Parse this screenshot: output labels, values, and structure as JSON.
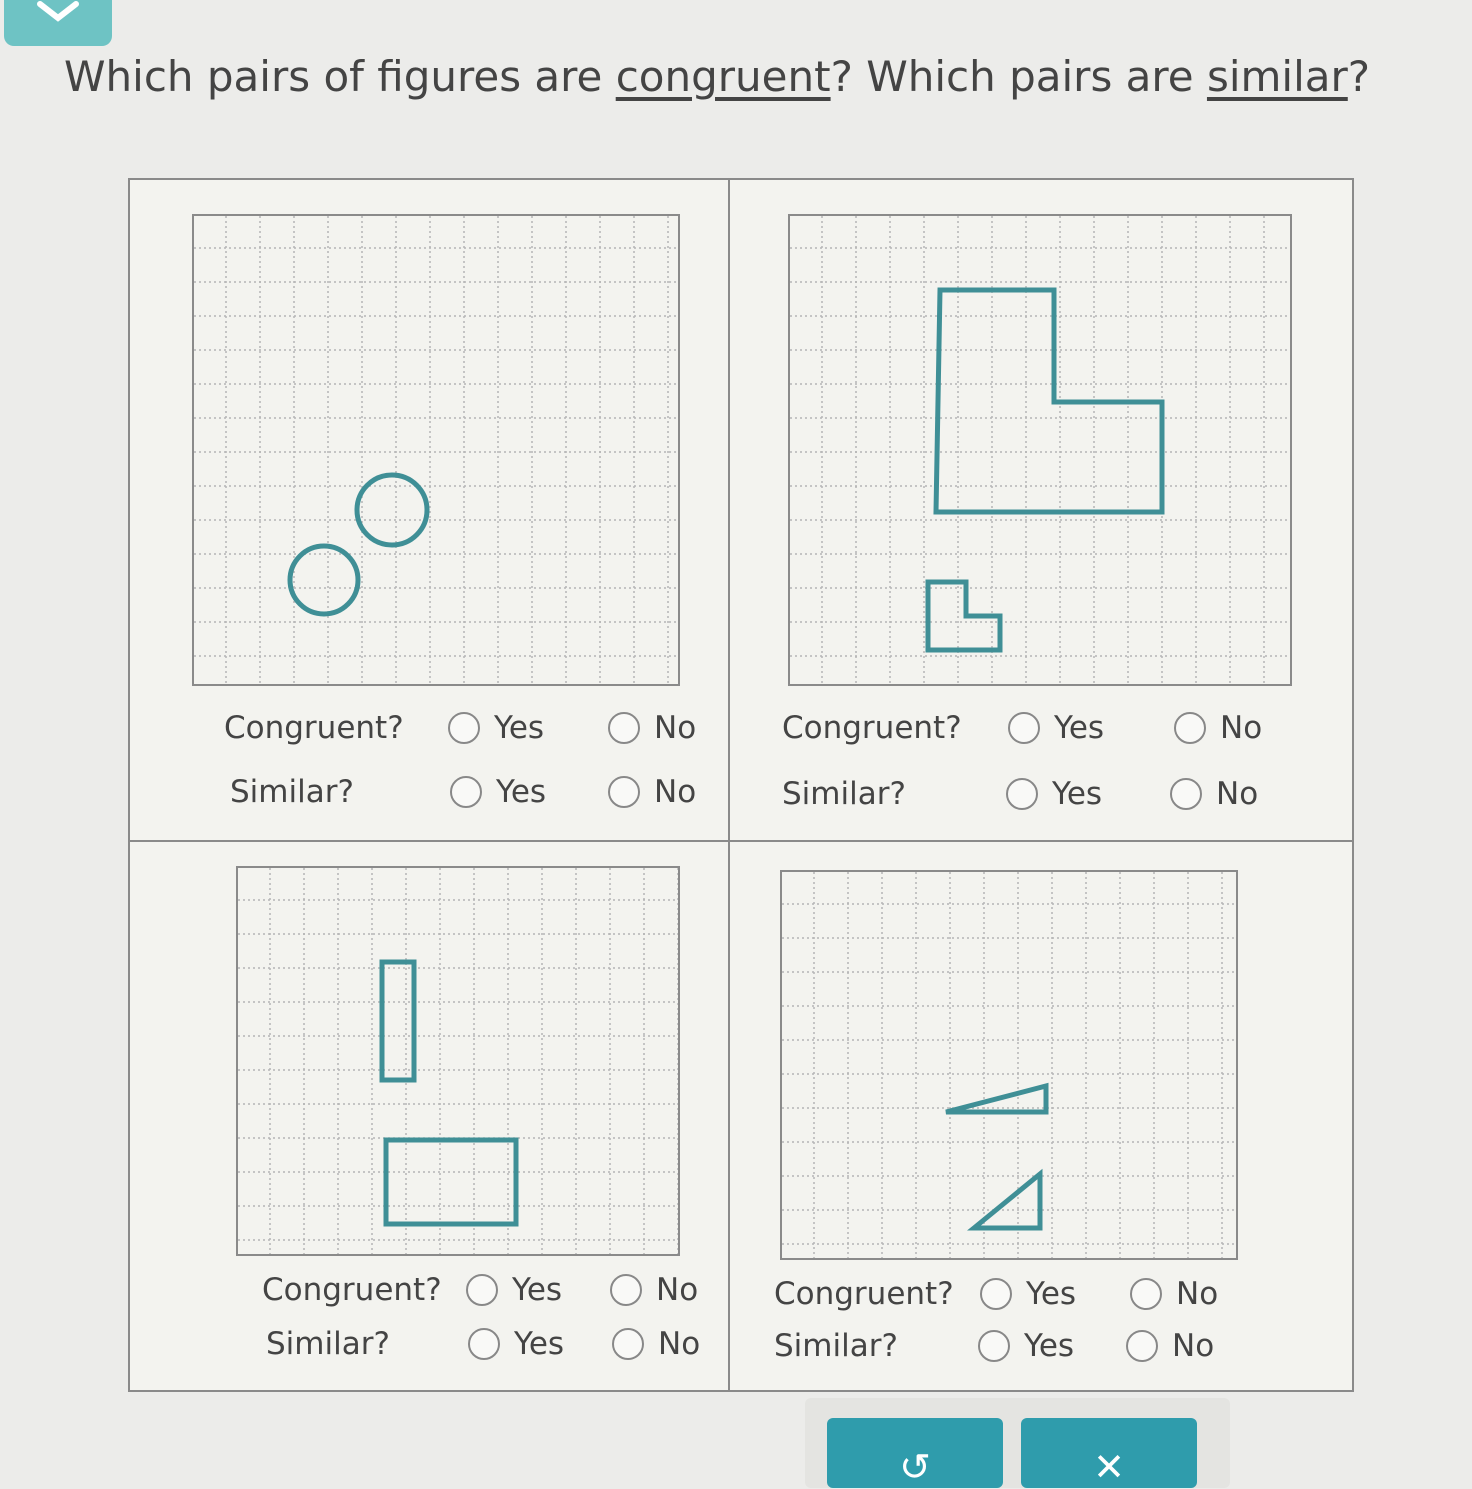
{
  "colors": {
    "accent": "#2f9cac",
    "shape_stroke": "#3f8f96",
    "tab": "#6ec3c4"
  },
  "question": {
    "prefix": "Which pairs of figures are ",
    "term1": "congruent",
    "middle": "? Which pairs are ",
    "term2": "similar",
    "suffix": "?"
  },
  "labels": {
    "congruent": "Congruent?",
    "similar": "Similar?",
    "yes": "Yes",
    "no": "No"
  },
  "pairs": [
    {
      "id": 1,
      "figures": "two-circles"
    },
    {
      "id": 2,
      "figures": "two-l-shapes"
    },
    {
      "id": 3,
      "figures": "two-rectangles"
    },
    {
      "id": 4,
      "figures": "two-right-triangles"
    }
  ],
  "toolbar": {
    "undo_icon": "undo-icon",
    "clear_icon": "close-icon",
    "undo_glyph": "↺",
    "clear_glyph": "✕"
  }
}
